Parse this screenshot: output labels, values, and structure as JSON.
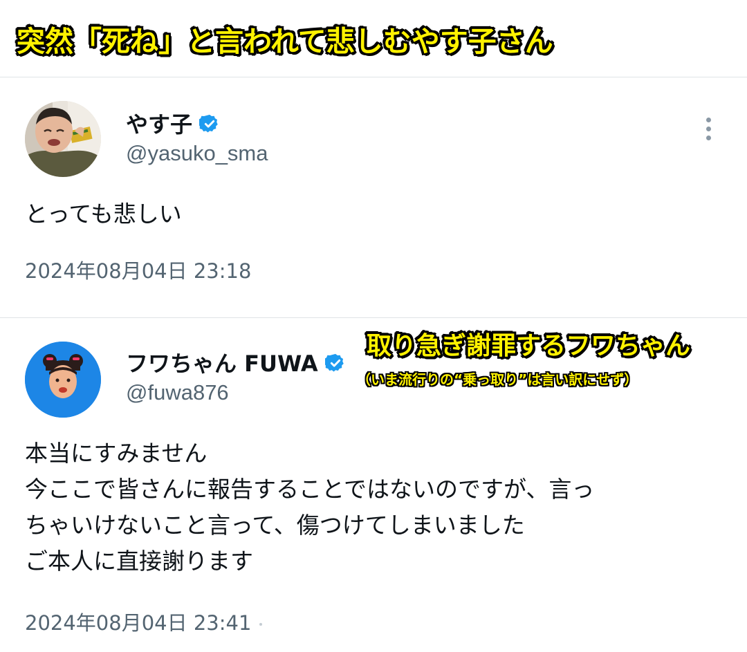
{
  "captions": {
    "headline": "突然「死ね」と言われて悲しむやす子さん",
    "fuwa_headline": "取り急ぎ謝罪するフワちゃん",
    "fuwa_subline": "（いま流行りの“乗っ取り”は言い訳にせず）"
  },
  "tweets": [
    {
      "display_name": "やす子",
      "handle": "@yasuko_sma",
      "verified": true,
      "text_lines": [
        "とっても悲しい"
      ],
      "timestamp": "2024年08月04日 23:18",
      "more_icon": "more-vertical-icon"
    },
    {
      "display_name": "フワちゃん FUWA",
      "handle": "@fuwa876",
      "verified": true,
      "text_lines": [
        "本当にすみません",
        "今ここで皆さんに報告することではないのですが、言っ",
        "ちゃいけないこと言って、傷つけてしまいました",
        "ご本人に直接謝ります"
      ],
      "timestamp": "2024年08月04日 23:41"
    }
  ],
  "colors": {
    "caption_fill": "#fff200",
    "caption_outline": "#000000",
    "verified_badge": "#1d9bf0",
    "handle_gray": "#536471",
    "fuwa_avatar_bg": "#1d86e6"
  }
}
